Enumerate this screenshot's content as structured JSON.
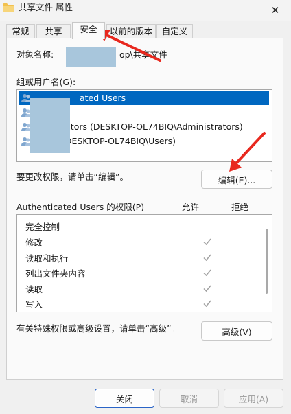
{
  "window": {
    "title": "共享文件 属性",
    "close_glyph": "✕"
  },
  "tabs": [
    {
      "label": "常规"
    },
    {
      "label": "共享"
    },
    {
      "label": "安全"
    },
    {
      "label": "以前的版本"
    },
    {
      "label": "自定义"
    }
  ],
  "security": {
    "object_name_label": "对象名称:",
    "object_name_value": "op\\共享文件",
    "groups_label": "组或用户名(G):",
    "users": [
      {
        "name": "ated Users",
        "selected": true
      },
      {
        "name": "",
        "selected": false
      },
      {
        "name": "rators (DESKTOP-OL74BIQ\\Administrators)",
        "selected": false
      },
      {
        "name": "Users (DESKTOP-OL74BIQ\\Users)",
        "selected": false
      }
    ],
    "edit_hint": "要更改权限，请单击“编辑”。",
    "edit_button": "编辑(E)...",
    "perm_header": "Authenticated Users 的权限(P)",
    "allow_header": "允许",
    "deny_header": "拒绝",
    "permissions": [
      {
        "name": "完全控制",
        "allow": false
      },
      {
        "name": "修改",
        "allow": true
      },
      {
        "name": "读取和执行",
        "allow": true
      },
      {
        "name": "列出文件夹内容",
        "allow": true
      },
      {
        "name": "读取",
        "allow": true
      },
      {
        "name": "写入",
        "allow": true
      }
    ],
    "advanced_hint": "有关特殊权限或高级设置，请单击“高级”。",
    "advanced_button": "高级(V)"
  },
  "footer": {
    "close_button": "关闭",
    "cancel_button": "取消",
    "apply_button": "应用(A)"
  },
  "colors": {
    "selection": "#0067c0",
    "arrow": "#e8281e",
    "redaction": "#a8c6dc"
  }
}
